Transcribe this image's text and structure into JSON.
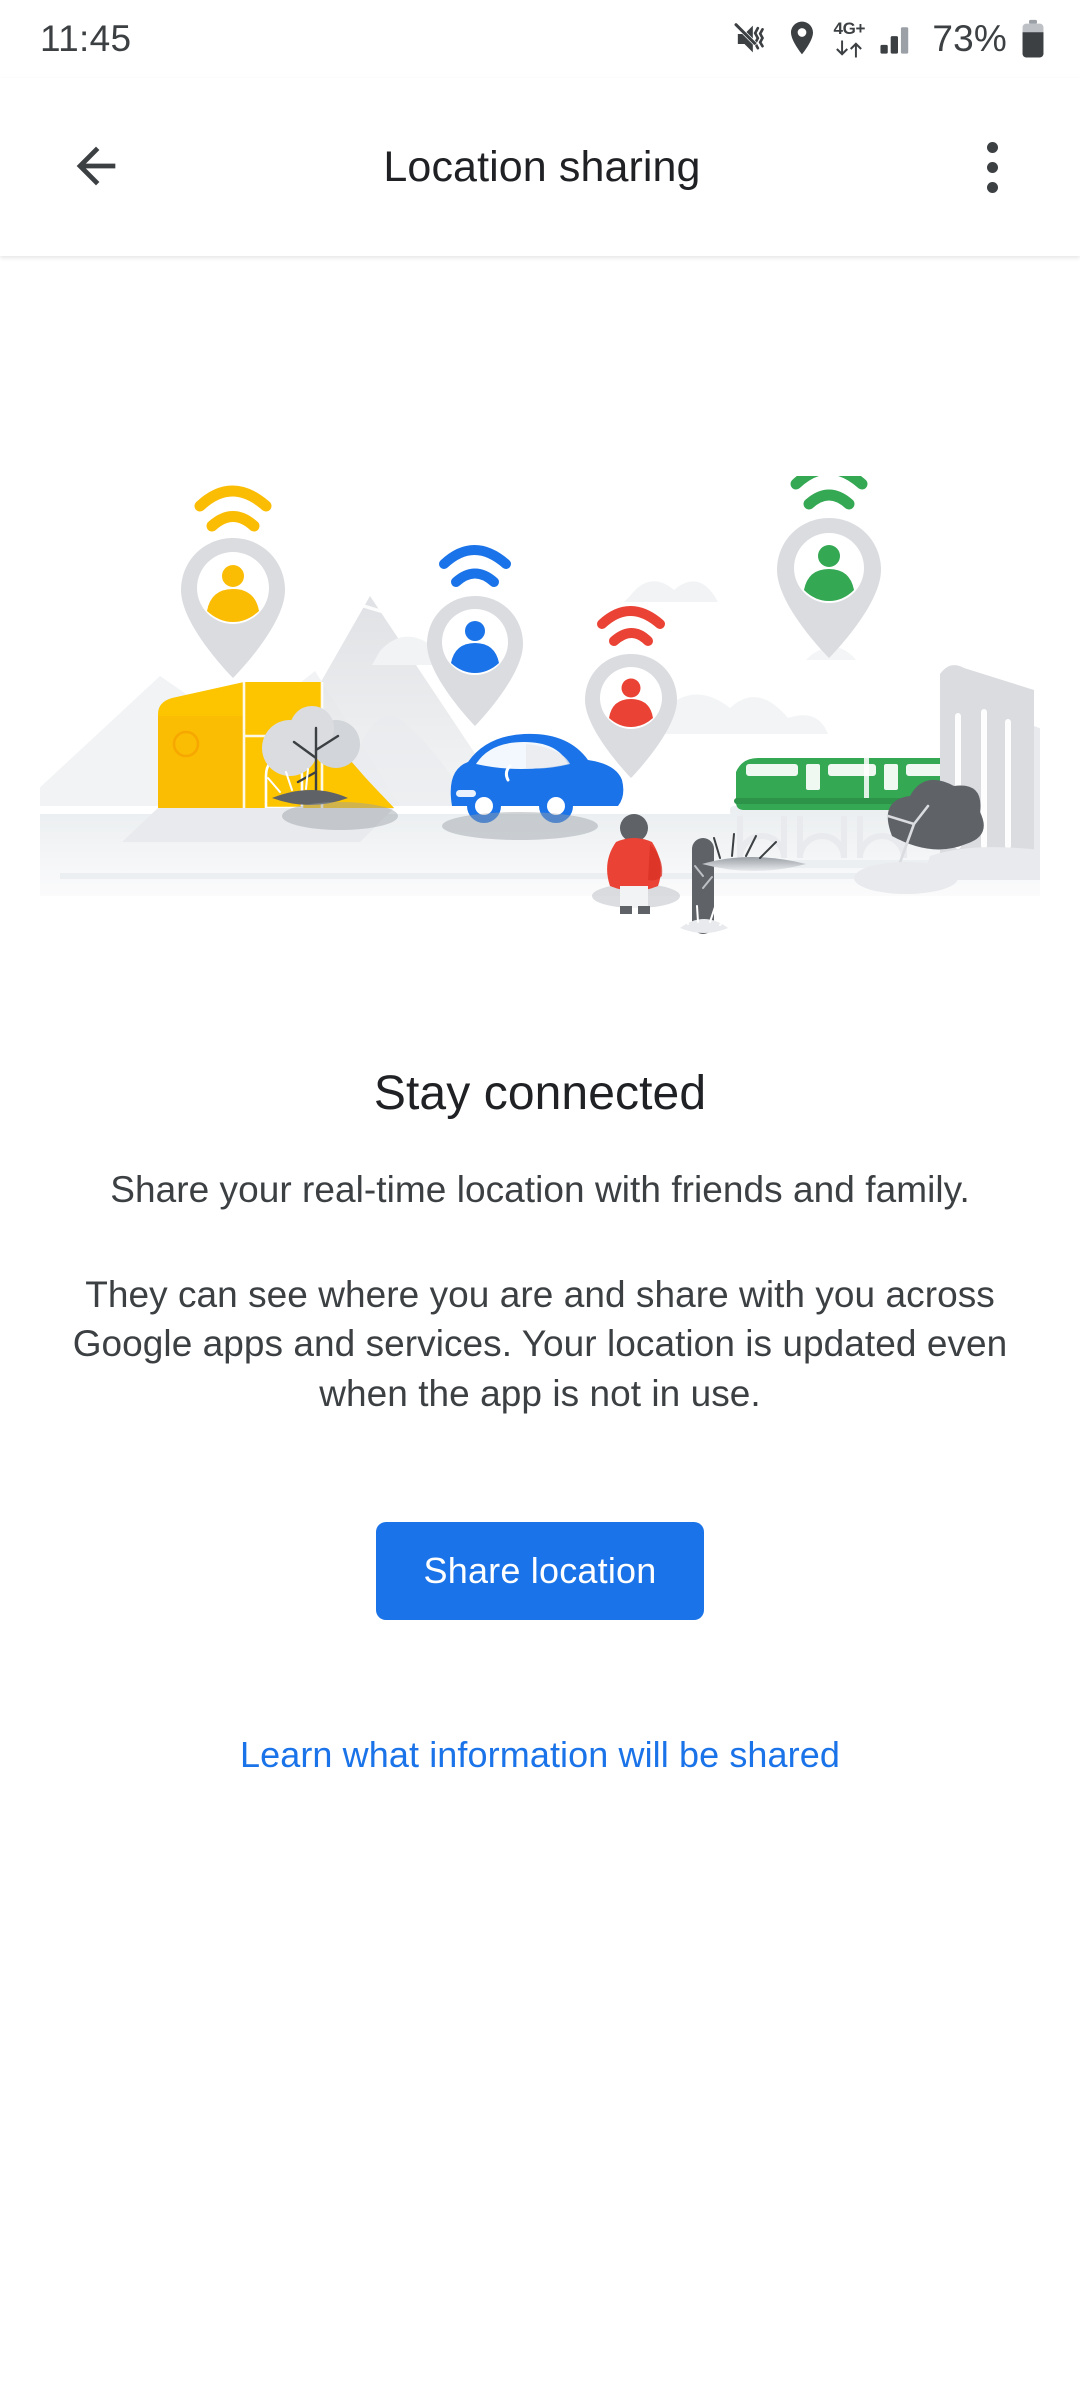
{
  "status_bar": {
    "time": "11:45",
    "battery_percent": "73%",
    "network_label": "4G+",
    "icons": [
      "mute-vibrate-icon",
      "location-pin-icon",
      "mobile-data-icon",
      "signal-bars-icon",
      "battery-icon"
    ]
  },
  "app_bar": {
    "title": "Location sharing",
    "back_icon": "back-arrow-icon",
    "overflow_icon": "overflow-menu-icon"
  },
  "illustration": {
    "name": "location-sharing-illustration",
    "alt": "City scene with location pins above a house, a car, a pedestrian and a train",
    "pins": [
      {
        "color": "#fbbc04",
        "subject": "house"
      },
      {
        "color": "#1a73e8",
        "subject": "car"
      },
      {
        "color": "#ea4335",
        "subject": "pedestrian"
      },
      {
        "color": "#34a853",
        "subject": "train"
      }
    ]
  },
  "main": {
    "headline": "Stay connected",
    "paragraph_1": "Share your real-time location with friends and family.",
    "paragraph_2": "They can see where you are and share with you across Google apps and services. Your location is updated even when the app is not in use.",
    "primary_button": "Share location",
    "learn_link": "Learn what information will be shared"
  },
  "colors": {
    "accent_blue": "#1a73e8",
    "link_blue": "#1a73e8",
    "google_yellow": "#fbbc04",
    "google_red": "#ea4335",
    "google_green": "#34a853",
    "text_primary": "#202124",
    "text_secondary": "#3c4043",
    "background": "#ffffff"
  }
}
